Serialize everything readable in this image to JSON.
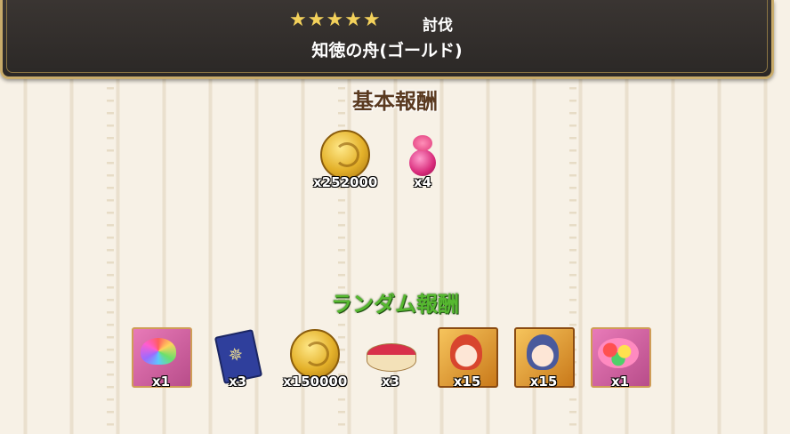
{
  "header": {
    "stars": "★★★★★",
    "quest_type": "討伐",
    "quest_name": "知徳の舟(ゴールド)"
  },
  "basic_rewards": {
    "heading": "基本報酬",
    "items": [
      {
        "icon": "gold-coin-icon",
        "count": "x252000"
      },
      {
        "icon": "rose-potion-icon",
        "count": "x4"
      }
    ]
  },
  "random_rewards": {
    "heading": "ランダム報酬",
    "items": [
      {
        "icon": "rainbow-lotus-icon",
        "count": "x1"
      },
      {
        "icon": "blue-book-icon",
        "count": "x3"
      },
      {
        "icon": "gold-coin-icon",
        "count": "x150000"
      },
      {
        "icon": "cherry-cake-icon",
        "count": "x3"
      },
      {
        "icon": "red-hair-character-icon",
        "count": "x15"
      },
      {
        "icon": "blue-hair-character-icon",
        "count": "x15"
      },
      {
        "icon": "flower-bouquet-icon",
        "count": "x1"
      }
    ]
  },
  "colors": {
    "banner_bg": "#2b2826",
    "banner_border": "#c9ac6b",
    "star_color": "#f3d15b",
    "basic_heading": "#5a3a20",
    "random_heading": "#56b830"
  }
}
